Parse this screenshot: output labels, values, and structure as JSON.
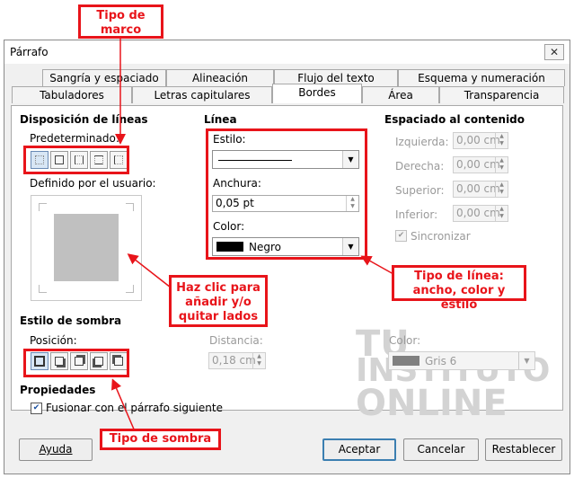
{
  "window": {
    "title": "Párrafo",
    "close": "✕"
  },
  "tabs_row1": [
    "Sangría y espaciado",
    "Alineación",
    "Flujo del texto",
    "Esquema y numeración"
  ],
  "tabs_row2": [
    "Tabuladores",
    "Letras capitulares",
    "Bordes",
    "Área",
    "Transparencia"
  ],
  "active_tab": "Bordes",
  "line_arrangement": {
    "header": "Disposición de líneas",
    "preset_label": "Predeterminado:",
    "user_label": "Definido por el usuario:"
  },
  "line": {
    "header": "Línea",
    "style_label": "Estilo:",
    "width_label": "Anchura:",
    "width_value": "0,05 pt",
    "color_label": "Color:",
    "color_value": "Negro",
    "color_swatch": "#000000"
  },
  "padding": {
    "header": "Espaciado al contenido",
    "left_label": "Izquierda:",
    "right_label": "Derecha:",
    "top_label": "Superior:",
    "bottom_label": "Inferior:",
    "left_value": "0,00 cm",
    "right_value": "0,00 cm",
    "top_value": "0,00 cm",
    "bottom_value": "0,00 cm",
    "sync_label": "Sincronizar"
  },
  "shadow": {
    "header": "Estilo de sombra",
    "position_label": "Posición:",
    "distance_label": "Distancia:",
    "distance_value": "0,18 cm",
    "color_label": "Color:",
    "color_value": "Gris 6",
    "color_swatch": "#808080"
  },
  "properties": {
    "header": "Propiedades",
    "merge_label": "Fusionar con el párrafo siguiente"
  },
  "buttons": {
    "help": "Ayuda",
    "accept": "Aceptar",
    "cancel": "Cancelar",
    "reset": "Restablecer"
  },
  "annotations": {
    "frame_type": "Tipo de marco",
    "click_sides": "Haz clic para añadir y/o quitar lados",
    "line_type": "Tipo de línea: ancho, color y estilo",
    "shadow_type": "Tipo de sombra",
    "accent": "#e8141a"
  },
  "watermark": {
    "line1": "TU",
    "line2": "INSTITUTO",
    "line3": "ONLINE"
  }
}
